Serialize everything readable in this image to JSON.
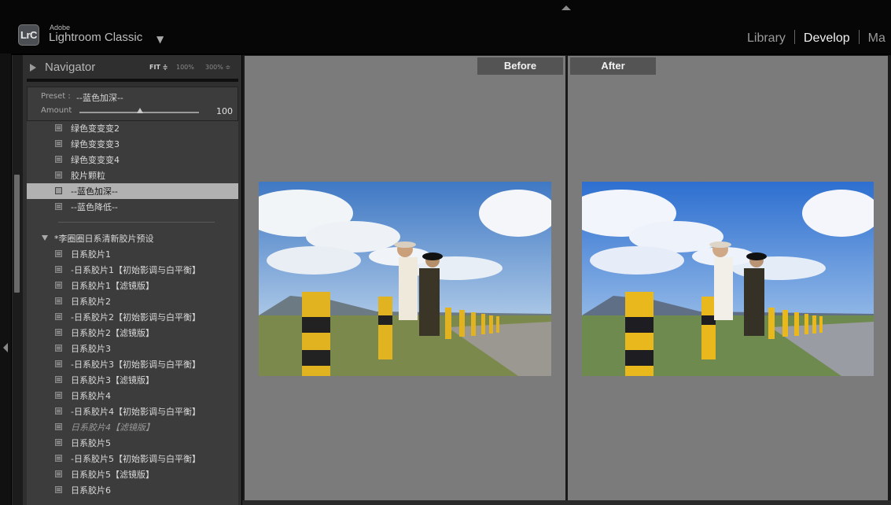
{
  "app": {
    "vendor": "Adobe",
    "name": "Lightroom Classic",
    "logo_text": "LrC",
    "menu_arrow": "▼"
  },
  "modules": {
    "items": [
      "Library",
      "Develop",
      "Ma"
    ],
    "active": "Develop"
  },
  "navigator": {
    "title": "Navigator",
    "zoom_options": [
      "FIT ≑",
      "100%",
      "300% ≑"
    ]
  },
  "preset_panel": {
    "preset_label": "Preset :",
    "preset_name": "--蓝色加深--",
    "amount_label": "Amount",
    "amount_value": "100",
    "amount_fraction": 1.0
  },
  "preset_list": {
    "items_top": [
      "绿色变变变2",
      "绿色变变变3",
      "绿色变变变4",
      "胶片颗粒",
      "--蓝色加深--",
      "--蓝色降低--"
    ],
    "selected": "--蓝色加深--",
    "folder": "*李圈圈日系清新胶片预设",
    "items_folder": [
      "日系胶片1",
      "-日系胶片1【初始影调与白平衡】",
      "日系胶片1【滤镜版】",
      "日系胶片2",
      "-日系胶片2【初始影调与白平衡】",
      "日系胶片2【滤镜版】",
      "日系胶片3",
      "-日系胶片3【初始影调与白平衡】",
      "日系胶片3【滤镜版】",
      "日系胶片4",
      "-日系胶片4【初始影调与白平衡】",
      "日系胶片4【滤镜版】",
      "日系胶片5",
      "-日系胶片5【初始影调与白平衡】",
      "日系胶片5【滤镜版】",
      "日系胶片6"
    ],
    "hover_item": "日系胶片4【滤镜版】"
  },
  "compare": {
    "before_label": "Before",
    "after_label": "After"
  },
  "colors": {
    "pane_bg": "#7b7b7b",
    "panel_bg": "#3c3c3c",
    "selected_row": "#b1b1b1"
  }
}
